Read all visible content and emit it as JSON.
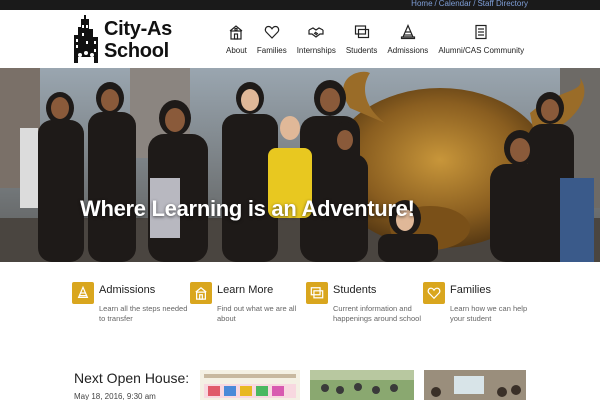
{
  "utility": {
    "links": [
      "Home",
      "Calendar",
      "Staff Directory"
    ],
    "separator": "/"
  },
  "logo": {
    "line1": "City-As",
    "line2": "School"
  },
  "nav": {
    "items": [
      {
        "label": "About",
        "icon": "school-building-icon"
      },
      {
        "label": "Families",
        "icon": "heart-icon"
      },
      {
        "label": "Internships",
        "icon": "handshake-icon"
      },
      {
        "label": "Students",
        "icon": "windows-icon"
      },
      {
        "label": "Admissions",
        "icon": "cone-icon"
      },
      {
        "label": "Alumni/CAS Community",
        "icon": "document-icon"
      }
    ]
  },
  "hero": {
    "title": "Where Learning is an Adventure!"
  },
  "features": [
    {
      "title": "Admissions",
      "desc": "Learn all the steps needed to transfer",
      "icon": "cone-icon"
    },
    {
      "title": "Learn More",
      "desc": "Find out what we are all about",
      "icon": "school-building-icon"
    },
    {
      "title": "Students",
      "desc": "Current information and happenings around school",
      "icon": "windows-icon"
    },
    {
      "title": "Families",
      "desc": "Learn how we can help your student",
      "icon": "heart-icon"
    }
  ],
  "open_house": {
    "heading": "Next Open House:",
    "date": "May 18, 2016, 9:30 am"
  },
  "colors": {
    "accent": "#d9a61e",
    "link": "#7f9fd8",
    "utility_bg": "#1a1a1a"
  }
}
